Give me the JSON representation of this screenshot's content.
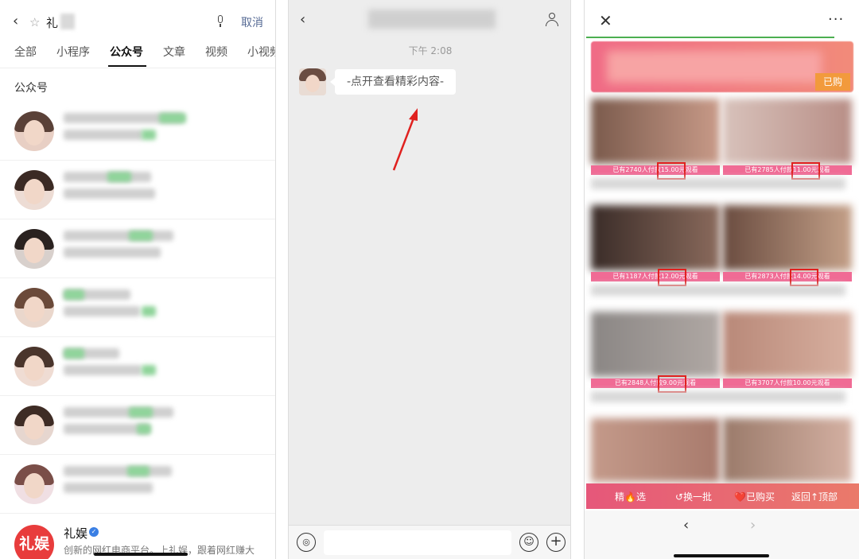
{
  "left": {
    "search": {
      "query": "礼",
      "cancel_label": "取消"
    },
    "tabs": [
      "全部",
      "小程序",
      "公众号",
      "文章",
      "视频",
      "小视频"
    ],
    "section_title": "公众号",
    "result": {
      "logo_text": "礼娱",
      "name": "礼娱",
      "verified_mark": "✓",
      "description": "创新的网红电商平台。上礼娱，跟着网红赚大"
    }
  },
  "middle": {
    "timestamp": "下午 2:08",
    "message": "-点开查看精彩内容-",
    "voice_glyph": "◎",
    "emoji_glyph": "☺",
    "plus_glyph": "+"
  },
  "right": {
    "close_glyph": "✕",
    "more_glyph": "···",
    "bought_tag": "已购",
    "pay_labels": [
      [
        "已有2740人付款15.00元观看",
        "已有2785人付款11.00元观看"
      ],
      [
        "已有1187人付款12.00元观看",
        "已有2873人付款14.00元观看"
      ],
      [
        "已有2848人付款9.00元观看",
        "已有3707人付款10.00元观看"
      ]
    ],
    "bottom_nav": [
      "精🔥选",
      "↺换一批",
      "❤️已购买",
      "返回↑顶部"
    ],
    "prev_glyph": "‹",
    "next_glyph": "›"
  },
  "colors": {
    "pink_bar": "#f06b95",
    "highlight_red": "#e0211f",
    "cancel_blue": "#576b95",
    "progress_green": "#4caf50"
  }
}
